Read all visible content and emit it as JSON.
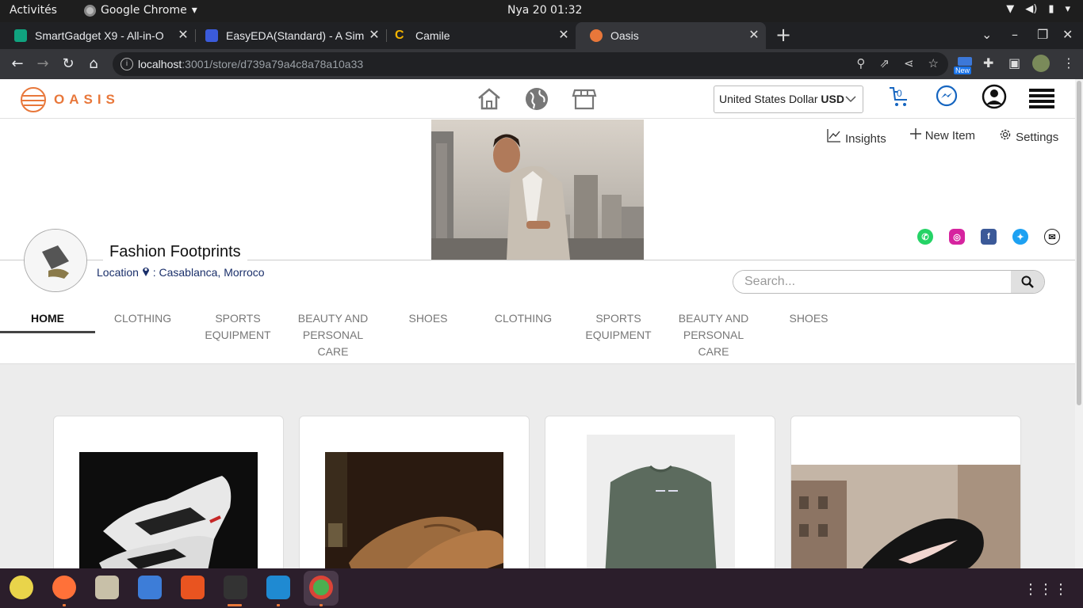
{
  "system": {
    "activities": "Activités",
    "app_name": "Google Chrome",
    "clock": "Nya 20  01:32"
  },
  "browser": {
    "tabs": [
      {
        "title": "SmartGadget X9 - All-in-O",
        "favicon_color": "#10a37f"
      },
      {
        "title": "EasyEDA(Standard) - A Sim",
        "favicon_color": "#3b5bdb"
      },
      {
        "title": "Camile",
        "favicon_color": "#f4b400"
      },
      {
        "title": "Oasis",
        "favicon_color": "#e8773a"
      }
    ],
    "url_host": "localhost",
    "url_rest": ":3001/store/d739a79a4c8a78a10a33",
    "ext_badge": "New"
  },
  "header": {
    "logo_text": "OASIS",
    "currency_name": "United States Dollar",
    "currency_code": "USD",
    "cart_count": "0"
  },
  "store": {
    "name": "Fashion Footprints",
    "location_label": "Location",
    "location_value": ": Casablanca, Morroco",
    "actions": {
      "insights": "Insights",
      "new_item": "New Item",
      "settings": "Settings"
    },
    "search_placeholder": "Search..."
  },
  "categories": [
    {
      "label": "HOME",
      "active": true
    },
    {
      "label": "CLOTHING"
    },
    {
      "label": "SPORTS EQUIPMENT"
    },
    {
      "label": "BEAUTY AND PERSONAL CARE"
    },
    {
      "label": "SHOES"
    },
    {
      "label": "CLOTHING"
    },
    {
      "label": "SPORTS EQUIPMENT"
    },
    {
      "label": "BEAUTY AND PERSONAL CARE"
    },
    {
      "label": "SHOES"
    }
  ],
  "colors": {
    "brand": "#e8773a",
    "link": "#1a2f6a"
  },
  "products": [
    {
      "image": "white-black-sneakers"
    },
    {
      "image": "brown-leather-loafers"
    },
    {
      "image": "green-sweatshirt"
    },
    {
      "image": "black-nike-sneakers"
    }
  ]
}
